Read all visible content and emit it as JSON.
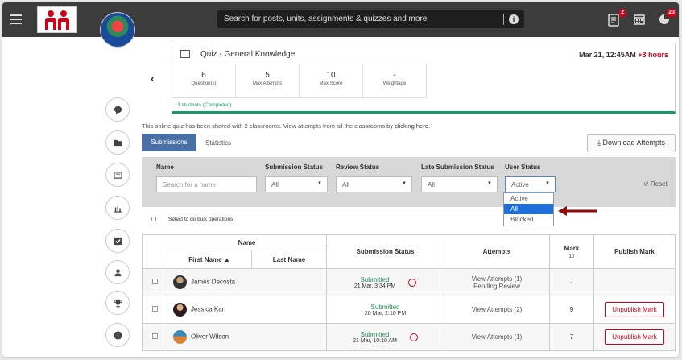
{
  "header": {
    "search_placeholder": "Search for posts, units, assignments & quizzes and more",
    "badges": {
      "assignments": "2",
      "notifications": "23"
    }
  },
  "quiz": {
    "title": "Quiz - General Knowledge",
    "date": "Mar 21, 12:45AM",
    "late": "+3 hours",
    "stats": [
      {
        "value": "6",
        "label": "Question(s)"
      },
      {
        "value": "5",
        "label": "Max Attempts"
      },
      {
        "value": "10",
        "label": "Max Score"
      },
      {
        "value": "-",
        "label": "Weightage"
      }
    ],
    "completed": "3 students (Completed)"
  },
  "shared_text": "This online quiz has been shared with 2 classrooms. View attempts from all the classrooms by",
  "shared_link": "clicking here.",
  "tabs": {
    "submissions": "Submissions",
    "statistics": "Statistics"
  },
  "download_label": "Download Attempts",
  "filters": {
    "name_label": "Name",
    "name_placeholder": "Search for a name",
    "submission_status_label": "Submission Status",
    "submission_status_value": "All",
    "review_status_label": "Review Status",
    "review_status_value": "All",
    "late_status_label": "Late Submission Status",
    "late_status_value": "All",
    "user_status_label": "User Status",
    "user_status_value": "Active",
    "reset_label": "Reset",
    "user_status_options": [
      "Active",
      "All",
      "Blocked"
    ]
  },
  "bulk_label": "Select to do bulk operations",
  "table": {
    "headers": {
      "name": "Name",
      "first_name": "First Name",
      "last_name": "Last Name",
      "submission_status": "Submission Status",
      "attempts": "Attempts",
      "mark": "Mark",
      "mark_sub": "10",
      "publish_mark": "Publish Mark"
    },
    "rows": [
      {
        "name": "James Decosta",
        "status": "Submitted",
        "date": "21 Mar, 3:34 PM",
        "late": true,
        "attempts": "View Attempts (1)",
        "attempts_sub": "Pending Review",
        "mark": "-",
        "publish": ""
      },
      {
        "name": "Jessica Karl",
        "status": "Submitted",
        "date": "20 Mar, 2:10 PM",
        "late": false,
        "attempts": "View Attempts (2)",
        "attempts_sub": "",
        "mark": "9",
        "publish": "Unpublish Mark"
      },
      {
        "name": "Oliver Wilson",
        "status": "Submitted",
        "date": "21 Mar, 10:10 AM",
        "late": true,
        "attempts": "View Attempts (1)",
        "attempts_sub": "",
        "mark": "7",
        "publish": "Unpublish Mark"
      }
    ]
  },
  "icons": [
    "menu-icon",
    "logo",
    "search-info-icon",
    "assignment-icon",
    "calendar-icon",
    "notification-icon",
    "chat-icon",
    "folder-icon",
    "units-icon",
    "chart-icon",
    "check-icon",
    "user-icon",
    "trophy-icon",
    "info-icon"
  ]
}
